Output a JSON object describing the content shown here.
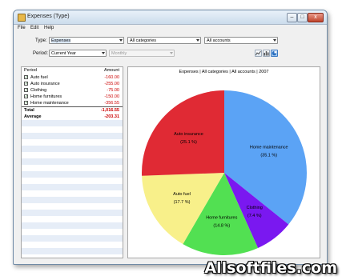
{
  "window": {
    "title": "Expenses (Type)",
    "controls": {
      "minimize": "–",
      "maximize": "□",
      "close": "x"
    }
  },
  "menu": [
    "File",
    "Edit",
    "Help"
  ],
  "filters": {
    "type_label": "Type:",
    "type_value": "Expenses",
    "category_value": "All categories",
    "accounts_value": "All accounts",
    "period_label": "Period:",
    "period_value": "Current Year",
    "interval_value": "Monthly"
  },
  "toolbar": {
    "icons": [
      "line-chart-icon",
      "bar-chart-icon",
      "pie-chart-icon"
    ]
  },
  "table": {
    "col_period": "Period",
    "col_amount": "Amount",
    "rows": [
      {
        "name": "Auto fuel",
        "amount": "-160.00",
        "checked": true
      },
      {
        "name": "Auto insurance",
        "amount": "-255.00",
        "checked": true
      },
      {
        "name": "Clothing",
        "amount": "-75.00",
        "checked": true
      },
      {
        "name": "Home furnitures",
        "amount": "-150.00",
        "checked": true
      },
      {
        "name": "Home maintenance",
        "amount": "-356.55",
        "checked": true
      }
    ],
    "total_label": "Total",
    "total_value": "-1,016.55",
    "average_label": "Average",
    "average_value": "-203.31"
  },
  "chart_data": {
    "type": "pie",
    "title": "Expenses | All categories | All accounts | 2007",
    "slices": [
      {
        "label": "Home maintenance",
        "percent_label": "(35.1 %)",
        "value": 356.55,
        "color": "#5ba3f5"
      },
      {
        "label": "Clothing",
        "percent_label": "(7.4 %)",
        "value": 75.0,
        "color": "#7a18f0"
      },
      {
        "label": "Home furnitures",
        "percent_label": "(14.8 %)",
        "value": 150.0,
        "color": "#52e052"
      },
      {
        "label": "Auto fuel",
        "percent_label": "(17.7 %)",
        "value": 160.0,
        "color": "#f8f08a"
      },
      {
        "label": "Auto insurance",
        "percent_label": "(25.1 %)",
        "value": 255.0,
        "color": "#e02a34"
      }
    ]
  },
  "watermark": "Allsoftfiles.com"
}
